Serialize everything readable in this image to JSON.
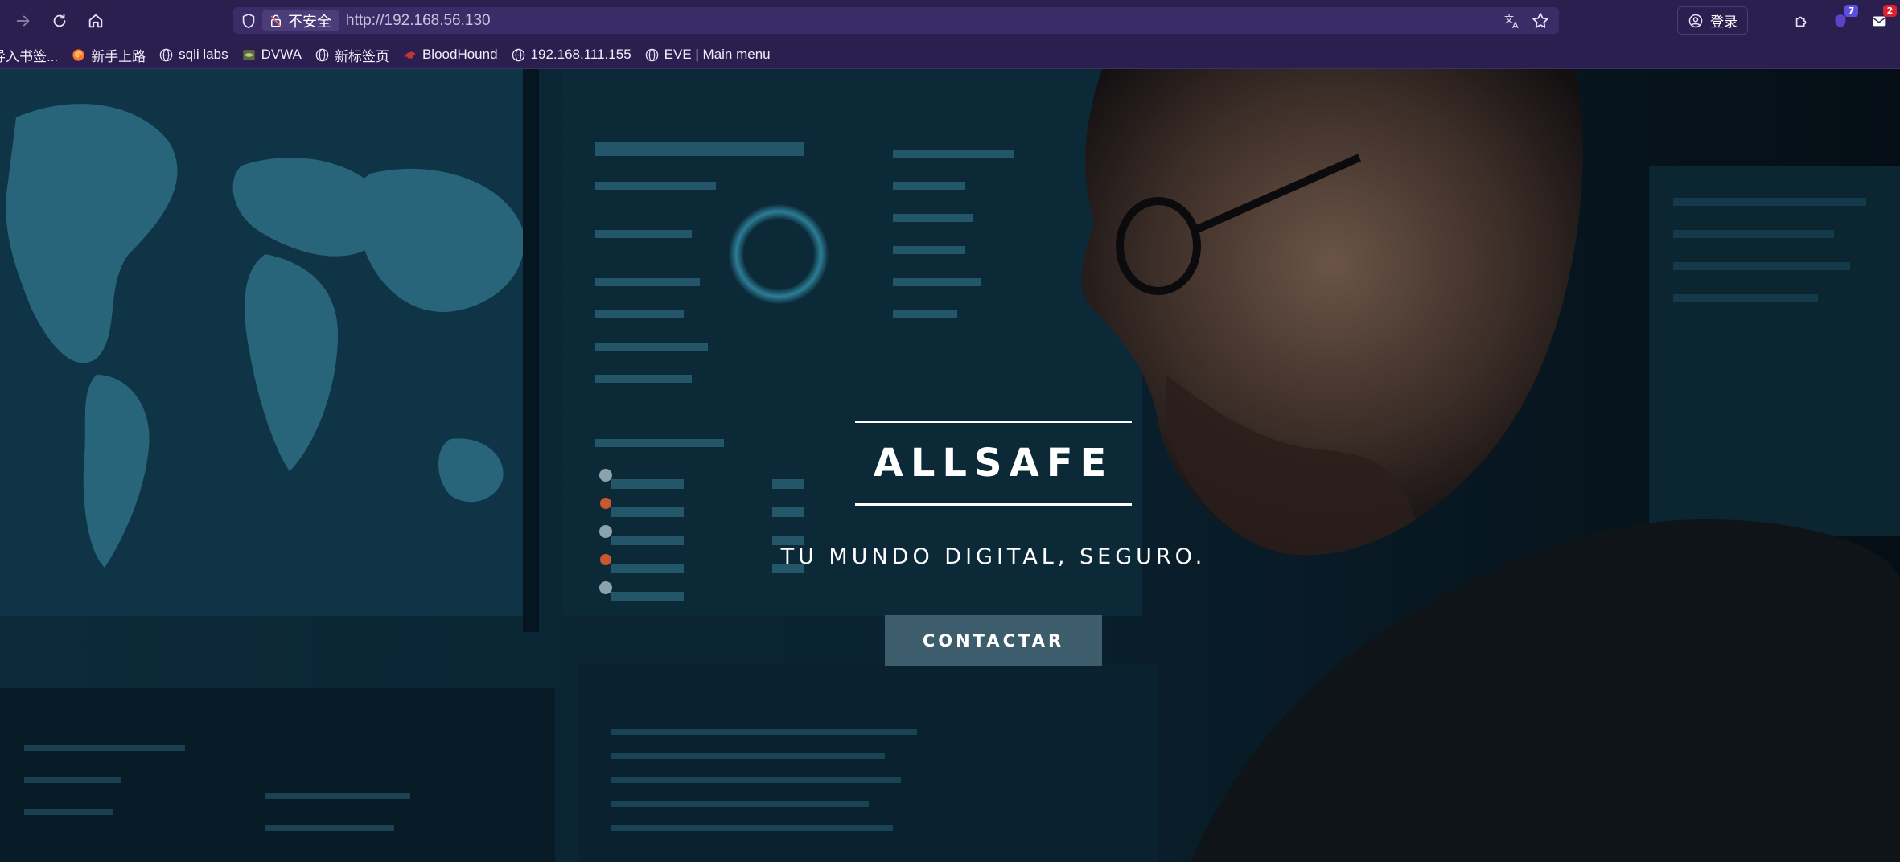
{
  "browser": {
    "url": "http://192.168.56.130",
    "security_label": "不安全",
    "login_label": "登录",
    "extension_badge": "7",
    "notification_badge": "2",
    "bookmarks": [
      {
        "label": "导入书签...",
        "icon": "import-icon"
      },
      {
        "label": "新手上路",
        "icon": "firefox-icon"
      },
      {
        "label": "sqli labs",
        "icon": "globe-icon"
      },
      {
        "label": "DVWA",
        "icon": "dvwa-icon"
      },
      {
        "label": "新标签页",
        "icon": "globe-icon"
      },
      {
        "label": "BloodHound",
        "icon": "bloodhound-icon"
      },
      {
        "label": "192.168.111.155",
        "icon": "globe-icon"
      },
      {
        "label": "EVE | Main menu",
        "icon": "globe-icon"
      }
    ]
  },
  "hero": {
    "brand": "ALLSAFE",
    "tagline": "TU MUNDO DIGITAL, SEGURO.",
    "cta_label": "CONTACTAR",
    "background_image": "analyst-at-security-monitors"
  },
  "colors": {
    "chrome_bg": "#2b1f4f",
    "urlbar_bg": "#3a2c66",
    "hero_overlay": "#061722",
    "cta_bg": "#3d5d6d",
    "text": "#ffffff"
  }
}
